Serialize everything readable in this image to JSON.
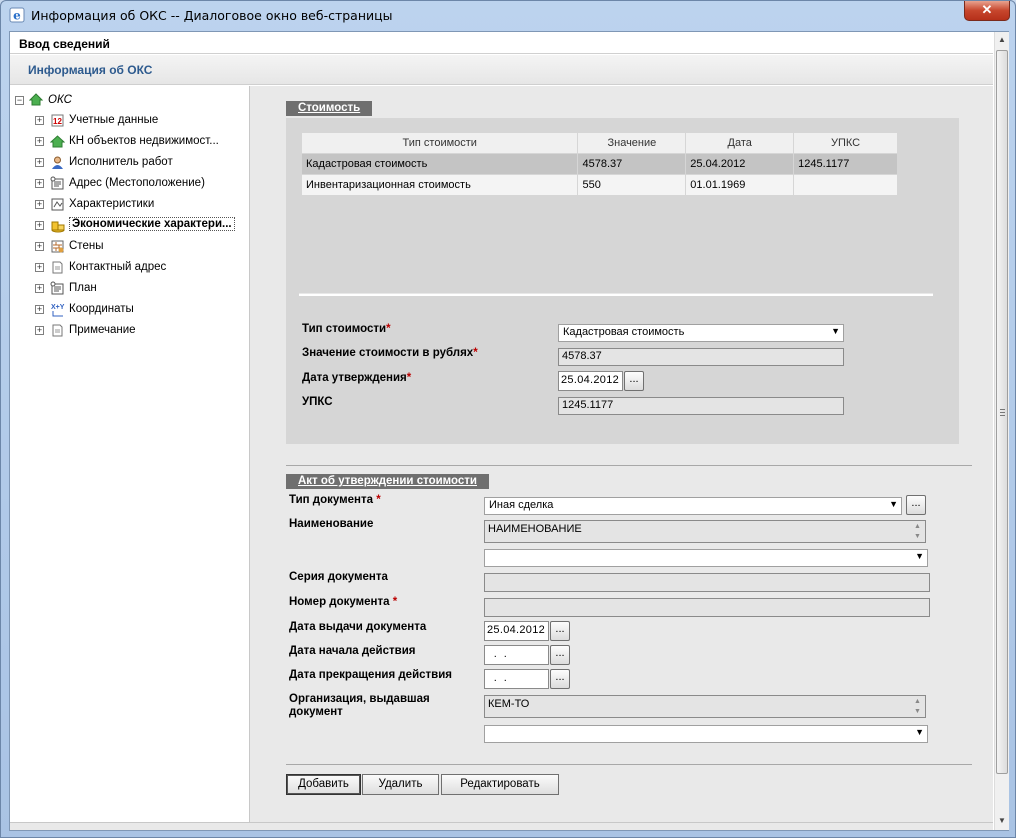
{
  "window": {
    "title": "Информация об ОКС -- Диалоговое окно веб-страницы",
    "close_label": "✕"
  },
  "header": {
    "title": "Ввод сведений"
  },
  "subheader": {
    "title": "Информация об ОКС"
  },
  "tree": {
    "root_label": "ОКС",
    "items": [
      {
        "label": "Учетные данные",
        "icon": "accounting-icon"
      },
      {
        "label": "КН объектов недвижимост...",
        "icon": "house-icon"
      },
      {
        "label": "Исполнитель работ",
        "icon": "person-icon"
      },
      {
        "label": "Адрес (Местоположение)",
        "icon": "address-icon"
      },
      {
        "label": "Характеристики",
        "icon": "characteristics-icon"
      },
      {
        "label": "Экономические характери...",
        "icon": "coins-icon",
        "selected": true
      },
      {
        "label": "Стены",
        "icon": "wall-icon"
      },
      {
        "label": "Контактный адрес",
        "icon": "document-icon"
      },
      {
        "label": "План",
        "icon": "plan-icon"
      },
      {
        "label": "Координаты",
        "icon": "coordinates-icon"
      },
      {
        "label": "Примечание",
        "icon": "note-icon"
      }
    ]
  },
  "cost": {
    "tab_label": "Стоимость",
    "table": {
      "headers": [
        "Тип стоимости",
        "Значение",
        "Дата",
        "УПКС"
      ],
      "rows": [
        [
          "Кадастровая стоимость",
          "4578.37",
          "25.04.2012",
          "1245.1177"
        ],
        [
          "Инвентаризационная стоимость",
          "550",
          "01.01.1969",
          ""
        ]
      ]
    },
    "fields": {
      "type_label": "Тип стоимости",
      "type_value": "Кадастровая стоимость",
      "value_label": "Значение стоимости в рублях",
      "value_value": "4578.37",
      "date_label": "Дата утверждения",
      "date_value": "25.04.2012",
      "upks_label": "УПКС",
      "upks_value": "1245.1177"
    }
  },
  "act": {
    "tab_label": "Акт об утверждении стоимости",
    "doc_type_label": "Тип документа",
    "doc_type_value": "Иная сделка",
    "name_label": "Наименование",
    "name_value": "НАИМЕНОВАНИЕ",
    "name_select_value": "",
    "series_label": "Серия документа",
    "series_value": "",
    "number_label": "Номер документа",
    "number_value": "",
    "issue_date_label": "Дата выдачи документа",
    "issue_date_value": "25.04.2012",
    "start_date_label": "Дата начала действия",
    "start_date_value": "  .  .    ",
    "end_date_label": "Дата прекращения действия",
    "end_date_value": "  .  .    ",
    "org_label": "Организация, выдавшая документ",
    "org_value": "КЕМ-ТО",
    "org_select_value": ""
  },
  "buttons": {
    "add": "Добавить",
    "delete": "Удалить",
    "edit": "Редактировать",
    "dots": "...",
    "required_mark": "*"
  }
}
